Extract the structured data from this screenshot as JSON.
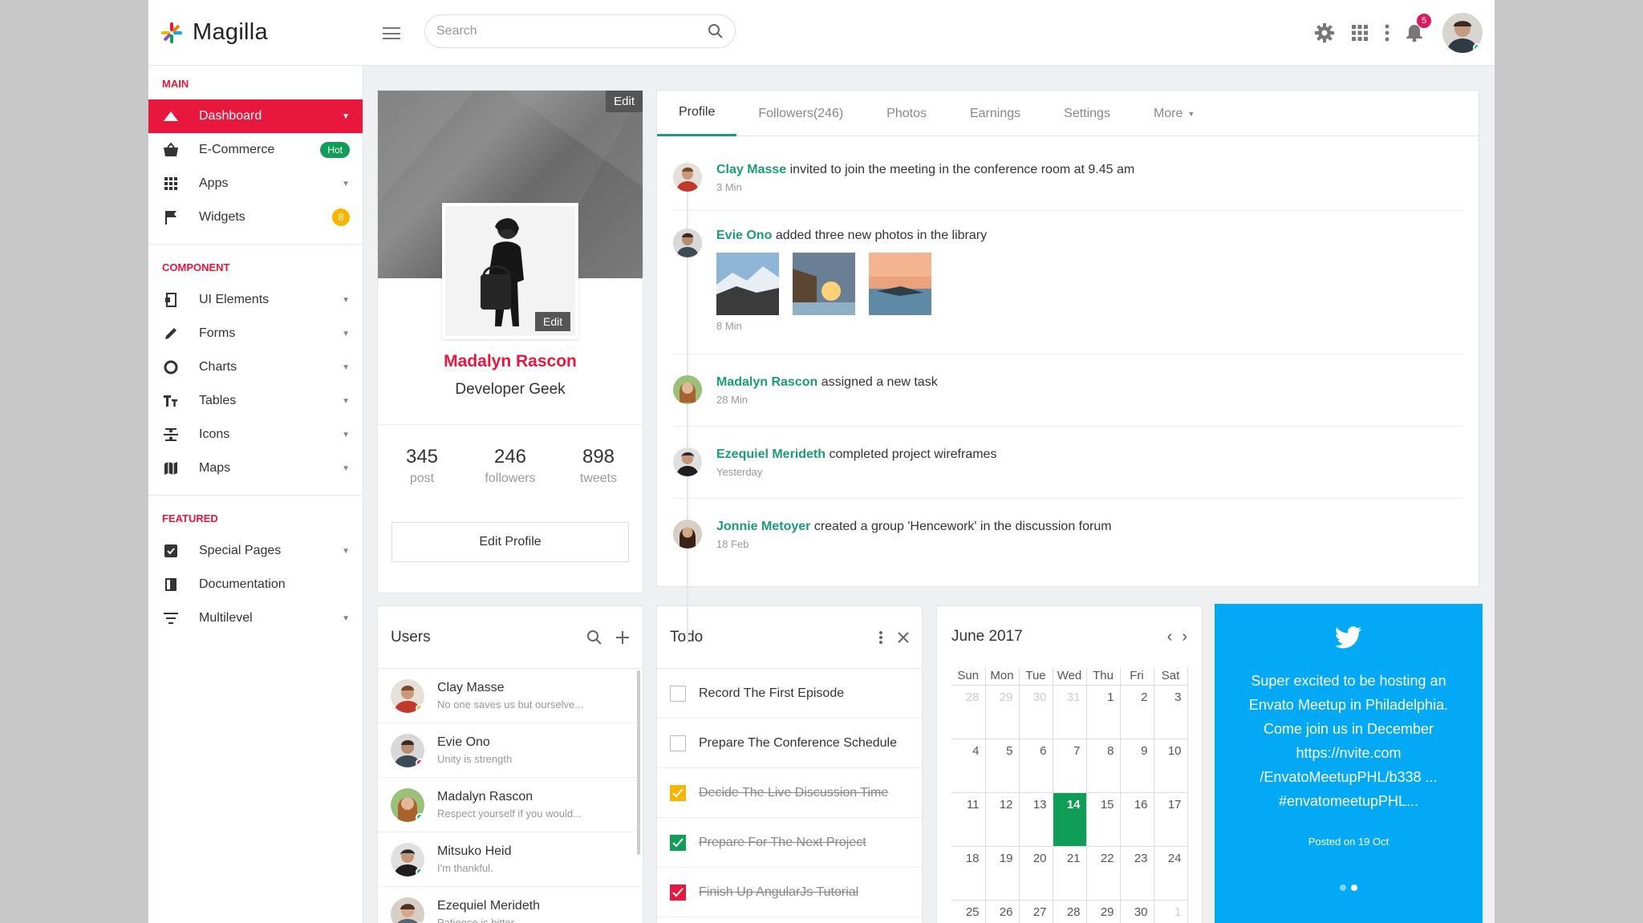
{
  "brand": {
    "name": "Magilla"
  },
  "search": {
    "placeholder": "Search"
  },
  "header": {
    "notification_count": "5"
  },
  "sidebar": {
    "main_label": "MAIN",
    "main": [
      {
        "label": "Dashboard"
      },
      {
        "label": "E-Commerce",
        "badge": "Hot"
      },
      {
        "label": "Apps"
      },
      {
        "label": "Widgets",
        "badge": "8"
      }
    ],
    "component_label": "COMPONENT",
    "component": [
      {
        "label": "UI Elements"
      },
      {
        "label": "Forms"
      },
      {
        "label": "Charts"
      },
      {
        "label": "Tables"
      },
      {
        "label": "Icons"
      },
      {
        "label": "Maps"
      }
    ],
    "featured_label": "FEATURED",
    "featured": [
      {
        "label": "Special Pages"
      },
      {
        "label": "Documentation"
      },
      {
        "label": "Multilevel"
      }
    ]
  },
  "profile": {
    "name": "Madalyn Rascon",
    "role": "Developer Geek",
    "edit_label": "Edit",
    "stats": [
      {
        "value": "345",
        "label": "post"
      },
      {
        "value": "246",
        "label": "followers"
      },
      {
        "value": "898",
        "label": "tweets"
      }
    ],
    "edit_profile_label": "Edit Profile"
  },
  "tabs": [
    {
      "label": "Profile"
    },
    {
      "label": "Followers(246)"
    },
    {
      "label": "Photos"
    },
    {
      "label": "Earnings"
    },
    {
      "label": "Settings"
    },
    {
      "label": "More"
    }
  ],
  "feed": [
    {
      "name": "Clay Masse",
      "text": "invited to join the meeting in the conference room at 9.45 am",
      "time": "3 Min"
    },
    {
      "name": "Evie Ono",
      "text": "added three new photos in the library",
      "time": "8 Min"
    },
    {
      "name": "Madalyn Rascon",
      "text": "assigned a new task",
      "time": "28 Min"
    },
    {
      "name": "Ezequiel Merideth",
      "text": "completed project wireframes",
      "time": "Yesterday"
    },
    {
      "name": "Jonnie Metoyer",
      "text": "created a group 'Hencework' in the discussion forum",
      "time": "18 Feb"
    }
  ],
  "users": {
    "title": "Users",
    "list": [
      {
        "name": "Clay Masse",
        "status": "No one saves us but ourselve..."
      },
      {
        "name": "Evie Ono",
        "status": "Unity is strength"
      },
      {
        "name": "Madalyn Rascon",
        "status": "Respect yourself if you would..."
      },
      {
        "name": "Mitsuko Heid",
        "status": "I'm thankful."
      },
      {
        "name": "Ezequiel Merideth",
        "status": "Patience is bitter."
      }
    ]
  },
  "todo": {
    "title": "Todo",
    "items": [
      {
        "text": "Record The First Episode",
        "done": false
      },
      {
        "text": "Prepare The Conference Schedule",
        "done": false
      },
      {
        "text": "Decide The Live Discussion Time",
        "done": true,
        "color": "#f7b500"
      },
      {
        "text": "Prepare For The Next Project",
        "done": true,
        "color": "#0f9d58"
      },
      {
        "text": "Finish Up AngularJs Tutorial",
        "done": true,
        "color": "#e8173d"
      }
    ]
  },
  "calendar": {
    "title": "June 2017",
    "weekdays": [
      "Sun",
      "Mon",
      "Tue",
      "Wed",
      "Thu",
      "Fri",
      "Sat"
    ],
    "weeks": [
      [
        "28",
        "29",
        "30",
        "31",
        "1",
        "2",
        "3"
      ],
      [
        "4",
        "5",
        "6",
        "7",
        "8",
        "9",
        "10"
      ],
      [
        "11",
        "12",
        "13",
        "14",
        "15",
        "16",
        "17"
      ],
      [
        "18",
        "19",
        "20",
        "21",
        "22",
        "23",
        "24"
      ],
      [
        "25",
        "26",
        "27",
        "28",
        "29",
        "30",
        "1"
      ]
    ],
    "today": "14"
  },
  "tweet": {
    "lines": [
      "Super excited to be hosting an",
      "Envato Meetup in Philadelphia.",
      "Come join us in December",
      "https://nvite.com",
      "/EnvatoMeetupPHL/b338 ...",
      "#envatomeetupPHL..."
    ],
    "posted": "Posted on 19 Oct"
  },
  "colors": {
    "accent": "#e8173d",
    "green": "#1a9c77",
    "twitter": "#03a9f4"
  }
}
